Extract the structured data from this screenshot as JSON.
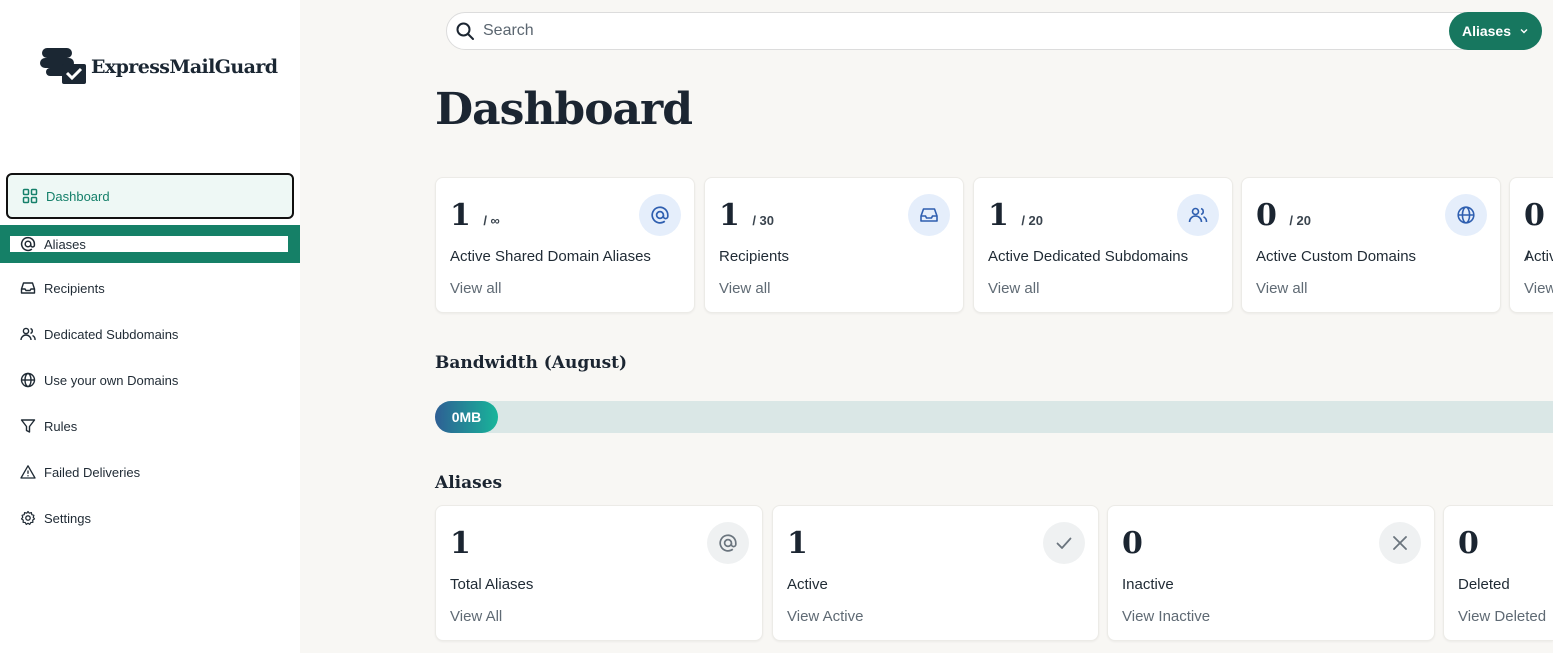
{
  "brand": {
    "name": "ExpressMailGuard"
  },
  "sidebar": {
    "items": [
      {
        "label": "Dashboard",
        "icon": "grid-icon"
      },
      {
        "label": "Aliases",
        "icon": "at-icon"
      },
      {
        "label": "Recipients",
        "icon": "inbox-icon"
      },
      {
        "label": "Dedicated Subdomains",
        "icon": "users-icon"
      },
      {
        "label": "Use your own Domains",
        "icon": "globe-icon"
      },
      {
        "label": "Rules",
        "icon": "filter-icon"
      },
      {
        "label": "Failed Deliveries",
        "icon": "warning-icon"
      },
      {
        "label": "Settings",
        "icon": "gear-icon"
      }
    ]
  },
  "search": {
    "placeholder": "Search",
    "scope_label": "Aliases"
  },
  "page": {
    "title": "Dashboard"
  },
  "stats": [
    {
      "count": "1",
      "max": "/ ∞",
      "label": "Active Shared Domain Aliases",
      "link": "View all",
      "icon": "at-icon"
    },
    {
      "count": "1",
      "max": "/ 30",
      "label": "Recipients",
      "link": "View all",
      "icon": "inbox-icon"
    },
    {
      "count": "1",
      "max": "/ 20",
      "label": "Active Dedicated Subdomains",
      "link": "View all",
      "icon": "users-icon"
    },
    {
      "count": "0",
      "max": "/ 20",
      "label": "Active Custom Domains",
      "link": "View all",
      "icon": "globe-icon"
    },
    {
      "count": "0",
      "max": "/",
      "label": "Activ",
      "link": "View",
      "icon": ""
    }
  ],
  "bandwidth": {
    "title": "Bandwidth (August)",
    "value_label": "0MB",
    "used_fraction": 0
  },
  "aliases_section": {
    "title": "Aliases",
    "cards": [
      {
        "count": "1",
        "label": "Total Aliases",
        "link": "View All",
        "icon": "at-icon"
      },
      {
        "count": "1",
        "label": "Active",
        "link": "View Active",
        "icon": "check-icon"
      },
      {
        "count": "0",
        "label": "Inactive",
        "link": "View Inactive",
        "icon": "close-icon"
      },
      {
        "count": "0",
        "label": "Deleted",
        "link": "View Deleted",
        "icon": ""
      }
    ]
  },
  "colors": {
    "accent": "#158067",
    "card_icon_bg": "#e5eefb",
    "active_nav_bg": "#eef8f5"
  }
}
